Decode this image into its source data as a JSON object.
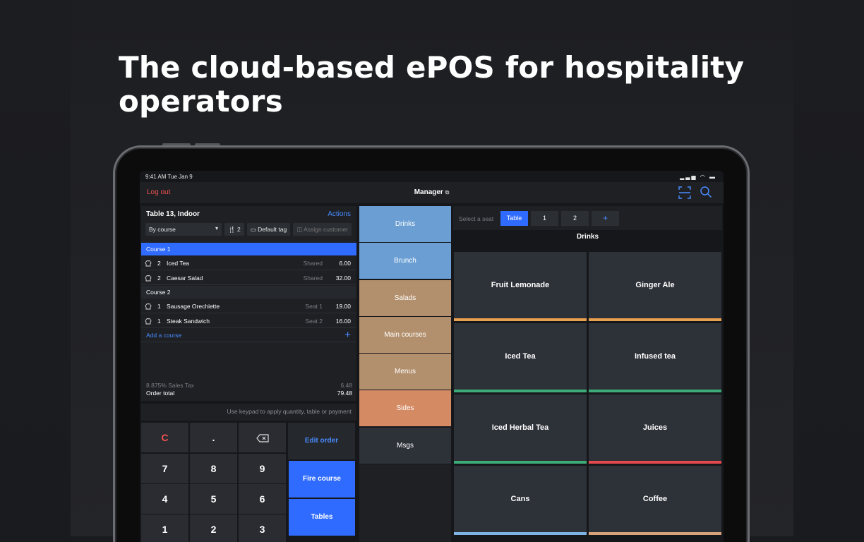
{
  "headline": "The cloud-based ePOS for hospitality operators",
  "status": {
    "time": "9:41 AM   Tue Jan 9"
  },
  "nav": {
    "logout": "Log out",
    "title": "Manager"
  },
  "order": {
    "title": "Table 13, Indoor",
    "actions": "Actions",
    "group_by": "By course",
    "covers": "2",
    "tag": "Default tag",
    "assign": "Assign customer",
    "course1": "Course 1",
    "course2": "Course 2",
    "items": [
      {
        "qty": "2",
        "name": "Iced Tea",
        "tag": "Shared",
        "price": "6.00"
      },
      {
        "qty": "2",
        "name": "Caesar Salad",
        "tag": "Shared",
        "price": "32.00"
      },
      {
        "qty": "1",
        "name": "Sausage Orechiette",
        "tag": "Seat 1",
        "price": "19.00"
      },
      {
        "qty": "1",
        "name": "Steak Sandwich",
        "tag": "Seat 2",
        "price": "16.00"
      }
    ],
    "add_course": "Add a course",
    "tax_label": "8.875% Sales Tax",
    "tax_value": "6.48",
    "total_label": "Order total",
    "total_value": "79.48"
  },
  "keypad": {
    "hint": "Use keypad to apply quantity, table or payment",
    "keys": [
      "C",
      ".",
      "7",
      "8",
      "9",
      "4",
      "5",
      "6",
      "1",
      "2",
      "3"
    ],
    "edit_order": "Edit order",
    "fire_course": "Fire course",
    "tables": "Tables"
  },
  "categories": [
    {
      "label": "Drinks",
      "color": "#6b9fd4"
    },
    {
      "label": "Brunch",
      "color": "#6b9fd4"
    },
    {
      "label": "Salads",
      "color": "#b3906d"
    },
    {
      "label": "Main courses",
      "color": "#b3906d"
    },
    {
      "label": "Menus",
      "color": "#b3906d"
    },
    {
      "label": "Sides",
      "color": "#d48a63"
    },
    {
      "label": "Msgs",
      "color": "#2d3138"
    }
  ],
  "seats": {
    "label": "Select a seat",
    "buttons": [
      "Table",
      "1",
      "2",
      "+"
    ]
  },
  "section_title": "Drinks",
  "tiles": [
    {
      "label": "Fruit Lemonade",
      "color": "#e8a14f"
    },
    {
      "label": "Ginger Ale",
      "color": "#e8a14f"
    },
    {
      "label": "Iced Tea",
      "color": "#3dab78"
    },
    {
      "label": "Infused tea",
      "color": "#3dab78"
    },
    {
      "label": "Iced Herbal Tea",
      "color": "#3dab78"
    },
    {
      "label": "Juices",
      "color": "#e5484d"
    },
    {
      "label": "Cans",
      "color": "#7fb2e5"
    },
    {
      "label": "Coffee",
      "color": "#d9a27a"
    }
  ]
}
